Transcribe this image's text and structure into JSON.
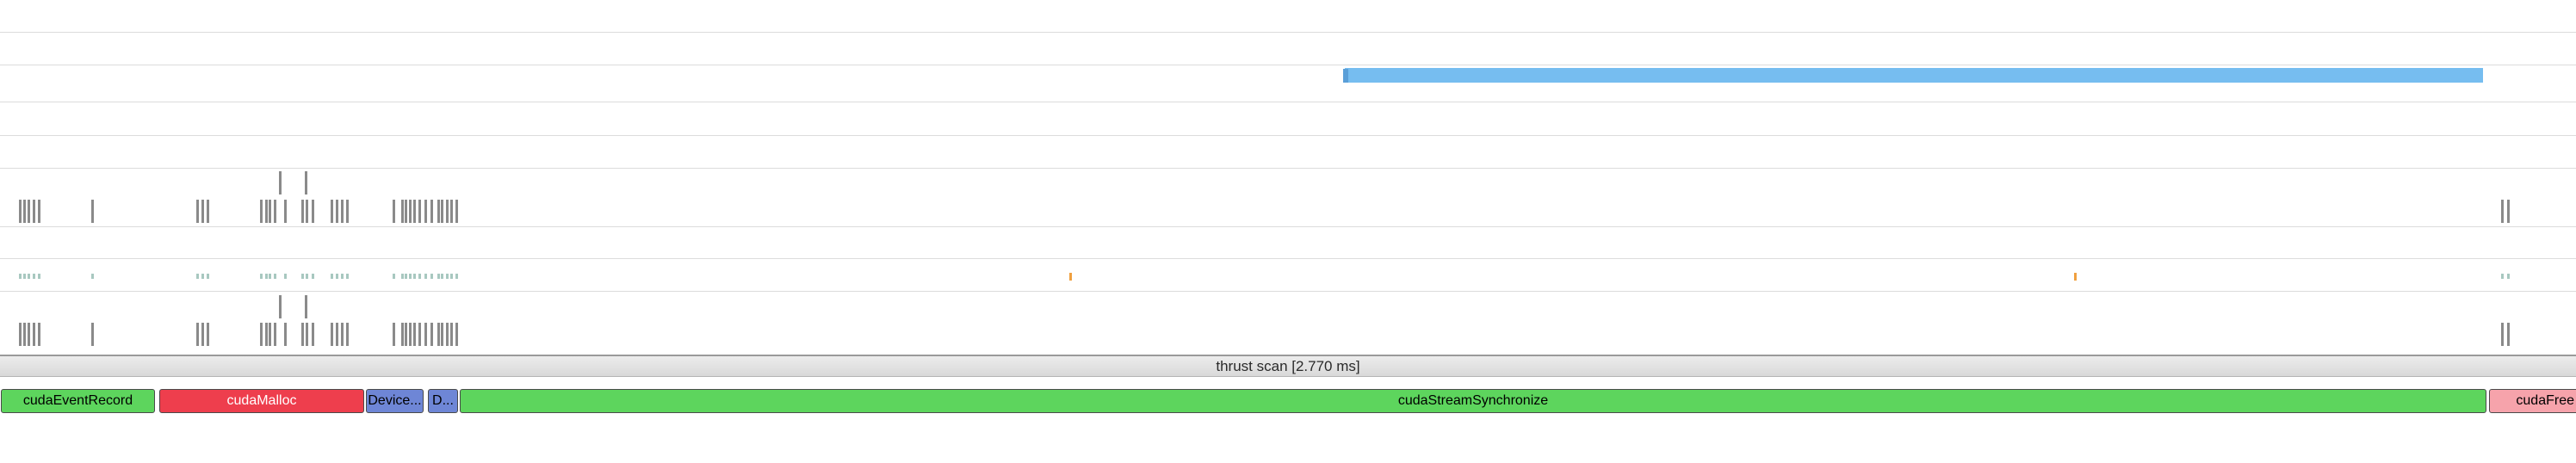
{
  "nvtx_range": {
    "label": "thrust scan [2.770 ms]"
  },
  "api_calls": [
    {
      "label": "cudaEventRecord",
      "color": "#5dd55d"
    },
    {
      "label": "cudaMalloc",
      "color": "#ee3e4d"
    },
    {
      "label": "Device...",
      "color": "#6e86d6"
    },
    {
      "label": "D...",
      "color": "#6e86d6"
    },
    {
      "label": "cudaStreamSynchronize",
      "color": "#5dd55d"
    },
    {
      "label": "cudaFree",
      "color": "#f6a3ab"
    }
  ],
  "colors": {
    "kernel": "#76bdf0",
    "sample_tick": "#8a8a8a",
    "thread_tick": "#a8c8c0",
    "highlight_tick": "#f0a040",
    "lane_separator": "#dcdcdc"
  }
}
